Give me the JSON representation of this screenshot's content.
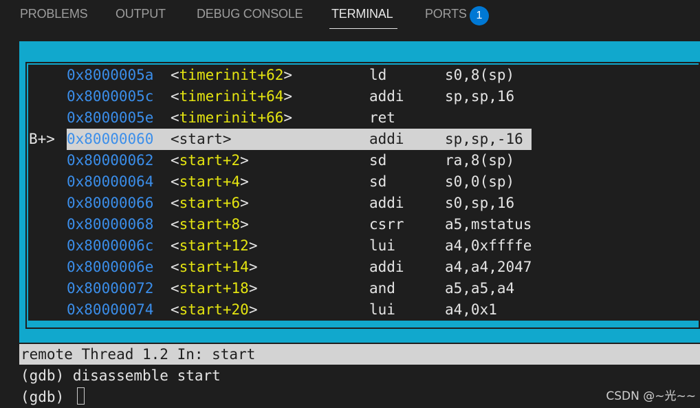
{
  "panel": {
    "tabs": [
      {
        "label": "PROBLEMS"
      },
      {
        "label": "OUTPUT"
      },
      {
        "label": "DEBUG CONSOLE"
      },
      {
        "label": "TERMINAL"
      },
      {
        "label": "PORTS"
      }
    ],
    "active_tab": "TERMINAL",
    "ports_badge": "1"
  },
  "disassembly": {
    "rows": [
      {
        "mark": "",
        "addr": "0x8000005a",
        "sym": "timerinit+62",
        "op": "ld",
        "args": "s0,8(sp)"
      },
      {
        "mark": "",
        "addr": "0x8000005c",
        "sym": "timerinit+64",
        "op": "addi",
        "args": "sp,sp,16"
      },
      {
        "mark": "",
        "addr": "0x8000005e",
        "sym": "timerinit+66",
        "op": "ret",
        "args": ""
      },
      {
        "mark": "B+>",
        "addr": "0x80000060",
        "sym": "start",
        "op": "addi",
        "args": "sp,sp,-16"
      },
      {
        "mark": "",
        "addr": "0x80000062",
        "sym": "start+2",
        "op": "sd",
        "args": "ra,8(sp)"
      },
      {
        "mark": "",
        "addr": "0x80000064",
        "sym": "start+4",
        "op": "sd",
        "args": "s0,0(sp)"
      },
      {
        "mark": "",
        "addr": "0x80000066",
        "sym": "start+6",
        "op": "addi",
        "args": "s0,sp,16"
      },
      {
        "mark": "",
        "addr": "0x80000068",
        "sym": "start+8",
        "op": "csrr",
        "args": "a5,mstatus"
      },
      {
        "mark": "",
        "addr": "0x8000006c",
        "sym": "start+12",
        "op": "lui",
        "args": "a4,0xffffe"
      },
      {
        "mark": "",
        "addr": "0x8000006e",
        "sym": "start+14",
        "op": "addi",
        "args": "a4,a4,2047"
      },
      {
        "mark": "",
        "addr": "0x80000072",
        "sym": "start+18",
        "op": "and",
        "args": "a5,a5,a4"
      },
      {
        "mark": "",
        "addr": "0x80000074",
        "sym": "start+20",
        "op": "lui",
        "args": "a4,0x1"
      }
    ]
  },
  "status_line": "remote Thread 1.2 In: start",
  "terminal": {
    "lines": [
      "(gdb) disassemble start",
      "(gdb) "
    ]
  },
  "watermark": "CSDN @~光~~",
  "colors": {
    "frame": "#11a8cd",
    "address": "#3b8eea",
    "symbol": "#e5e510",
    "highlight_bg": "#d3d3d3",
    "badge": "#0078d4"
  }
}
